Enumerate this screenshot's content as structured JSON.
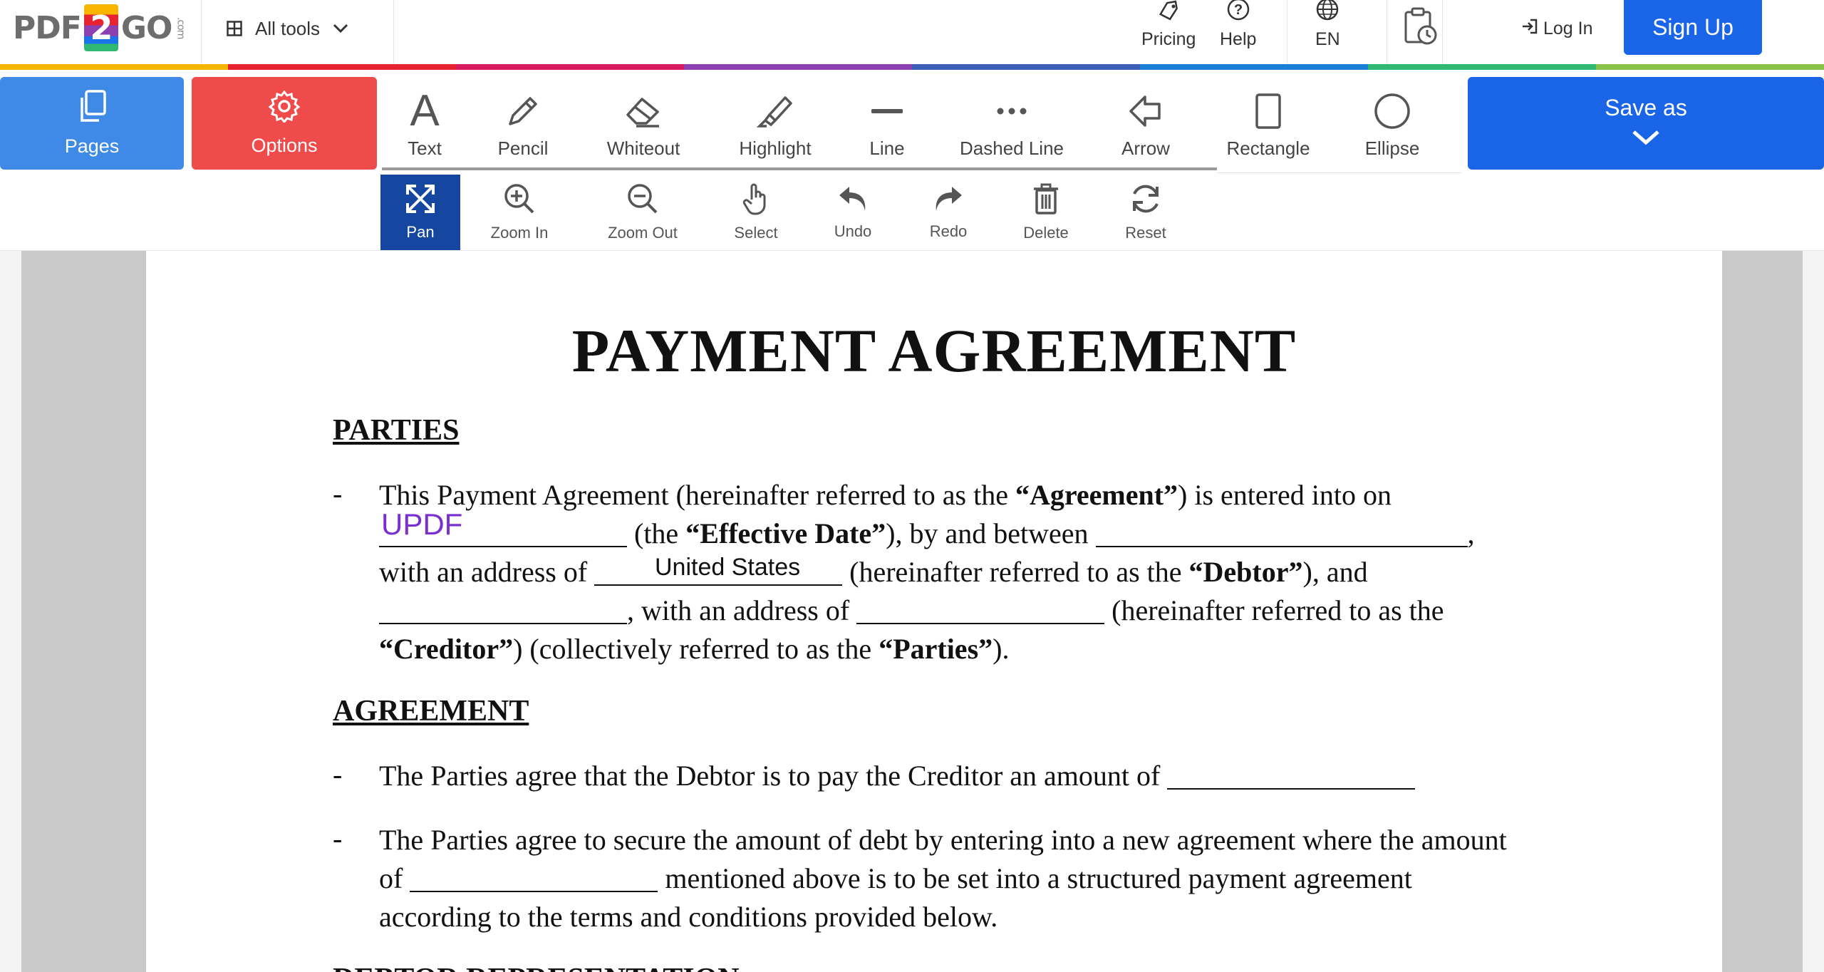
{
  "brand": {
    "logo_left": "PDF",
    "logo_mid": "2",
    "logo_right": "GO",
    "logo_suffix": ".com"
  },
  "nav": {
    "all_tools": "All tools",
    "pricing": "Pricing",
    "help": "Help",
    "language": "EN",
    "log_in": "Log In",
    "sign_up": "Sign Up"
  },
  "colors": {
    "rainbow": [
      "#f7b500",
      "#e6232f",
      "#d81b60",
      "#8b3fb0",
      "#3d5fb5",
      "#1a7fd6",
      "#2eb872",
      "#8bc34a"
    ]
  },
  "toolbar": {
    "pages": "Pages",
    "options": "Options",
    "tools": [
      "Text",
      "Pencil",
      "Whiteout",
      "Highlight",
      "Line",
      "Dashed Line",
      "Arrow",
      "Rectangle",
      "Ellipse"
    ],
    "save_as": "Save as"
  },
  "subtoolbar": {
    "items": [
      "Pan",
      "Zoom In",
      "Zoom Out",
      "Select",
      "Undo",
      "Redo",
      "Delete",
      "Reset"
    ],
    "active": "Pan"
  },
  "document": {
    "title": "PAYMENT AGREEMENT",
    "section1": "PARTIES",
    "bullet": "-",
    "p1": {
      "a": "This Payment Agreement (hereinafter referred to as the ",
      "b": "“Agreement”",
      "c": ") is entered into on",
      "d": " (the ",
      "e": "“Effective Date”",
      "f": "), by and between ",
      "g": ",",
      "h": "with an address of ",
      "i": " (hereinafter referred to as the ",
      "j": "“Debtor”",
      "k": "), and",
      "l": ", with an address of ",
      "m": " (hereinafter referred to as the",
      "n": "“Creditor”",
      "o": ") (collectively referred to as the ",
      "p": "“Parties”",
      "q": ")."
    },
    "fill_updf": "UPDF",
    "fill_us": "United States",
    "section2": "AGREEMENT",
    "p2": "The Parties agree that the Debtor is to pay the Creditor an amount of ",
    "p3a": "The Parties agree to secure the amount of debt by entering into a new agreement where the amount of ",
    "p3b": " mentioned above is to be set into a structured payment agreement according to the terms and conditions provided below.",
    "section3": "DEBTOR REPRESENTATION"
  }
}
